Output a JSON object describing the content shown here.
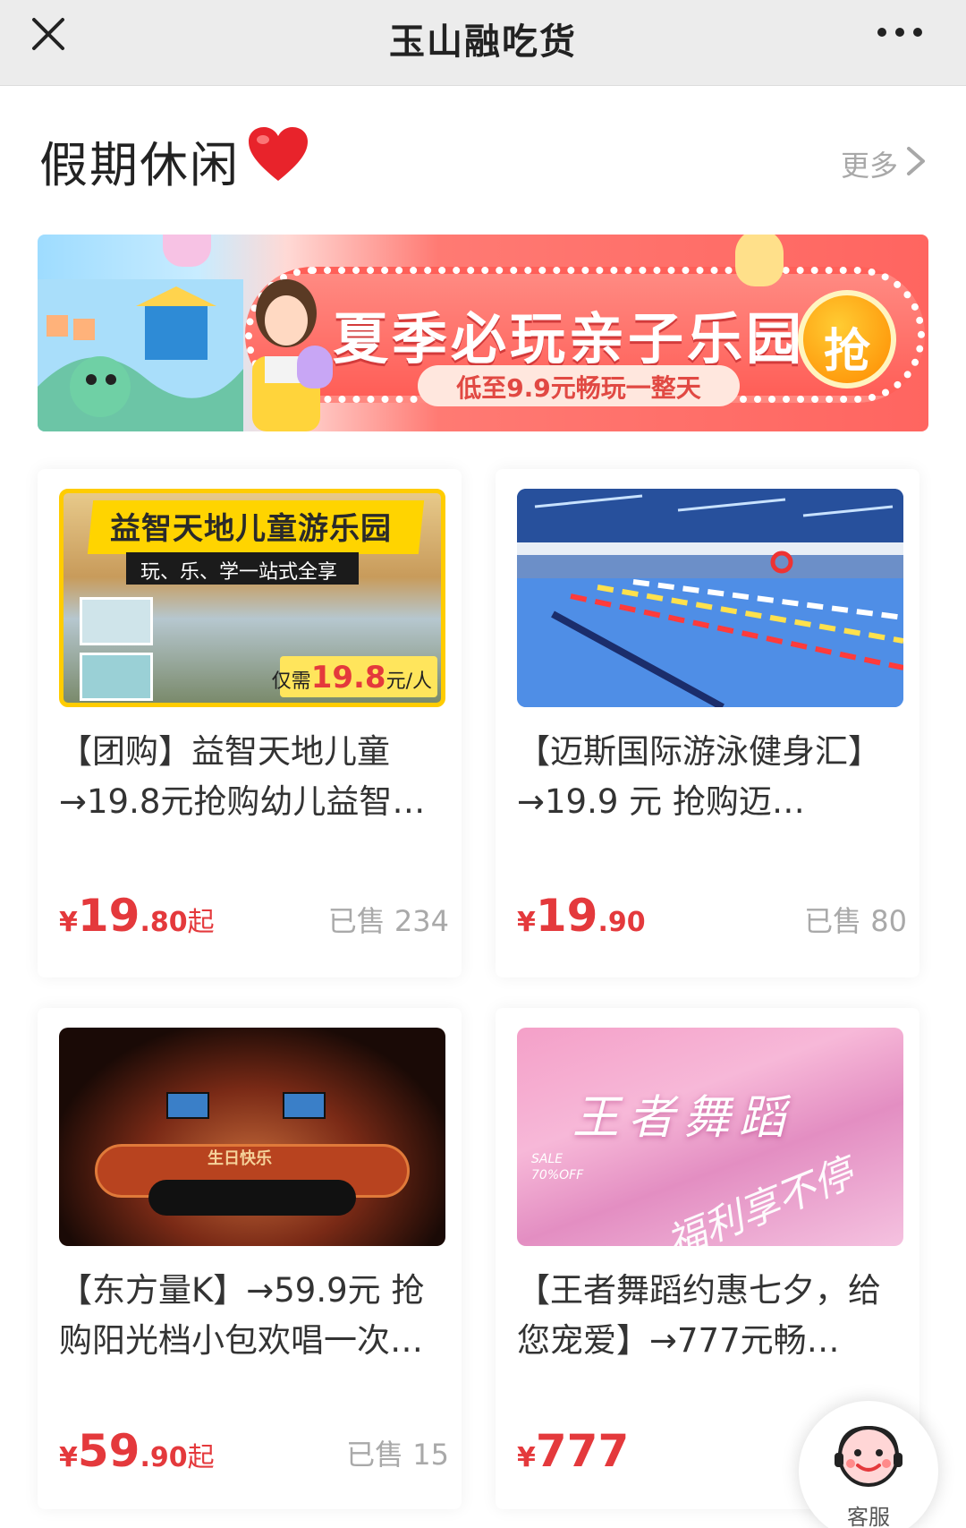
{
  "header": {
    "title": "玉山融吃货",
    "close_icon": "close-icon",
    "more_icon": "more-dots-icon"
  },
  "section": {
    "title": "假期休闲",
    "heart_icon": "heart-icon",
    "more_label": "更多"
  },
  "banner": {
    "headline": "夏季必玩亲子乐园",
    "subline": "低至9.9元畅玩一整天",
    "grab_label": "抢"
  },
  "cards": [
    {
      "image": {
        "banner_text": "益智天地儿童游乐园",
        "sub_text": "玩、乐、学一站式全享",
        "tag_prefix": "仅需",
        "tag_price": "19.8",
        "tag_unit": "元/人"
      },
      "title": "【团购】益智天地儿童→19.8元抢购幼儿益智…",
      "price": {
        "symbol": "¥",
        "int": "19",
        "dec": ".80",
        "suffix": "起"
      },
      "sold": "已售 234"
    },
    {
      "image": {},
      "title": "【迈斯国际游泳健身汇】→19.9 元 抢购迈…",
      "price": {
        "symbol": "¥",
        "int": "19",
        "dec": ".90",
        "suffix": ""
      },
      "sold": "已售 80"
    },
    {
      "image": {
        "room_sign": "生日快乐"
      },
      "title": "【东方量K】→59.9元 抢购阳光档小包欢唱一次…",
      "price": {
        "symbol": "¥",
        "int": "59",
        "dec": ".90",
        "suffix": "起"
      },
      "sold": "已售 15"
    },
    {
      "image": {
        "big_text": "王者舞蹈",
        "sale_text_1": "SALE",
        "sale_text_2": "70%OFF",
        "small_text": "福利享不停"
      },
      "title": "【王者舞蹈约惠七夕，给您宠爱】→777元畅…",
      "price": {
        "symbol": "¥",
        "int": "777",
        "dec": "",
        "suffix": ""
      },
      "sold": ""
    }
  ],
  "customer_service": {
    "label": "客服",
    "icon": "customer-service-icon"
  },
  "colors": {
    "price_red": "#e4393c",
    "banner_red": "#ff5e57",
    "heart": "#e8232b",
    "topbar_bg": "#ececec"
  }
}
